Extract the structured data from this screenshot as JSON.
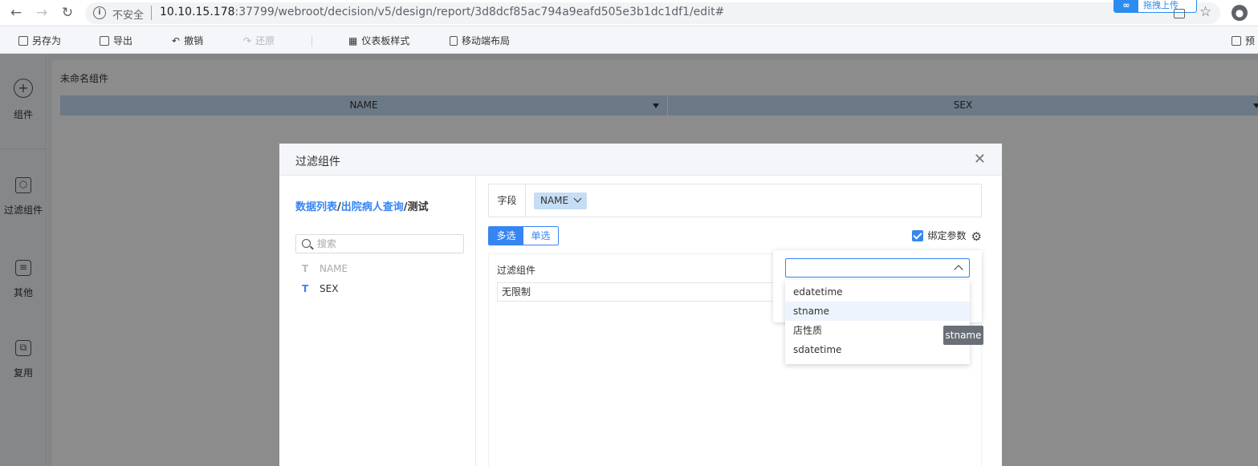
{
  "browser": {
    "back_icon": "arrow-left-icon",
    "forward_icon": "arrow-right-icon",
    "reload_icon": "reload-icon",
    "insecure_label": "不安全",
    "url_host": "10.10.15.178",
    "url_rest": ":37799/webroot/decision/v5/design/report/3d8dcf85ac794a9eafd505e3b1dc1df1/edit#",
    "extension_label": "拖拽上传"
  },
  "toolbar": {
    "items": [
      {
        "label": "另存为",
        "enabled": true
      },
      {
        "label": "导出",
        "enabled": true
      },
      {
        "label": "撤销",
        "enabled": true
      },
      {
        "label": "还原",
        "enabled": false
      },
      {
        "label": "仪表板样式",
        "enabled": true
      },
      {
        "label": "移动端布局",
        "enabled": true
      }
    ],
    "preview_label": "预"
  },
  "sidebar": {
    "items": [
      {
        "label": "组件",
        "icon": "plus-circle-icon"
      },
      {
        "label": "过滤组件",
        "icon": "cube-icon"
      },
      {
        "label": "其他",
        "icon": "document-icon"
      },
      {
        "label": "复用",
        "icon": "copy-icon"
      }
    ]
  },
  "widget": {
    "title": "未命名组件",
    "columns": [
      "NAME",
      "SEX"
    ]
  },
  "modal": {
    "title": "过滤组件",
    "breadcrumb": {
      "part1": "数据列表",
      "sep1": "/",
      "part2": "出院病人查询",
      "sep2": "/",
      "current": "测试"
    },
    "search_placeholder": "搜索",
    "fields": [
      {
        "type": "T",
        "name": "NAME",
        "disabled": true
      },
      {
        "type": "T",
        "name": "SEX",
        "disabled": false
      }
    ],
    "field_label": "字段",
    "field_value": "NAME",
    "mode_multi": "多选",
    "mode_single": "单选",
    "bind_param_label": "绑定参数",
    "bind_param_checked": true,
    "preview_title": "过滤组件",
    "preview_value": "无限制"
  },
  "param_dropdown": {
    "selected": "",
    "options": [
      "edatetime",
      "stname",
      "店性质",
      "sdatetime"
    ],
    "hovered": "stname",
    "tooltip": "stname"
  },
  "colors": {
    "accent": "#3685f2",
    "header_bg": "#c5ddf5",
    "overlay": "rgba(0,0,0,0.45)"
  }
}
